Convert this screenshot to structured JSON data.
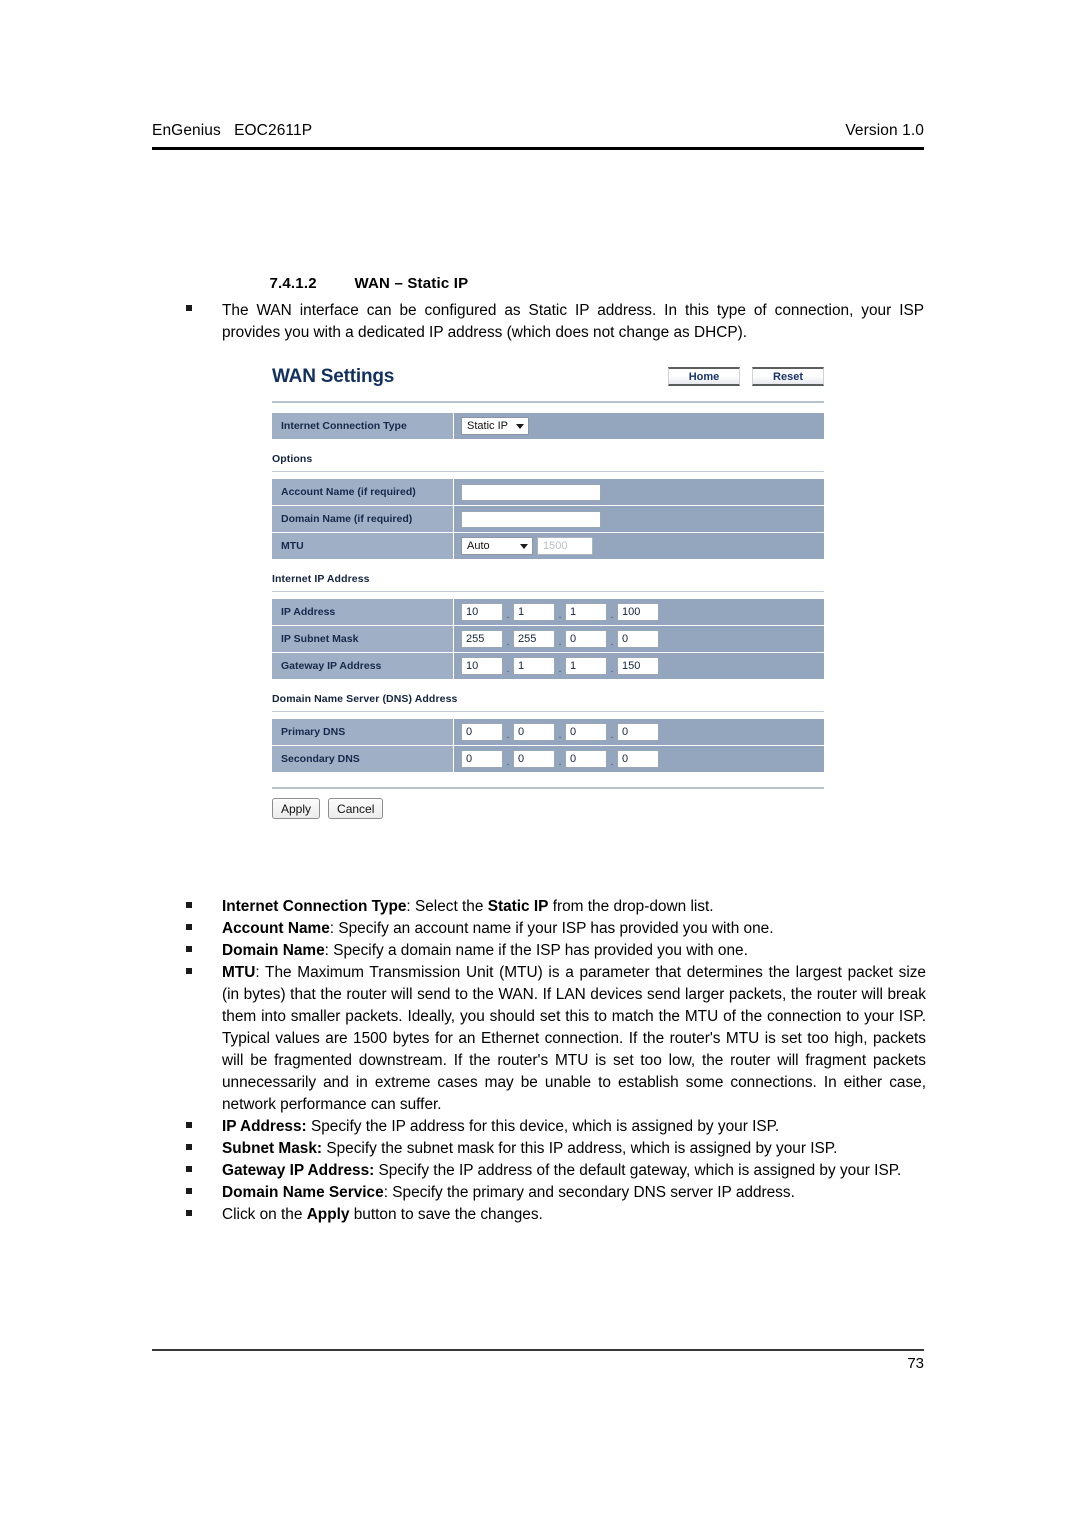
{
  "document": {
    "header_left": "EnGenius   EOC2611P",
    "header_right": "Version 1.0",
    "page_number": "73"
  },
  "section": {
    "number": "7.4.1.2",
    "title": "WAN – Static IP",
    "intro": "The WAN interface can be configured as Static IP address. In this type of connection, your ISP provides you with a dedicated IP address (which does not change as DHCP)."
  },
  "ui": {
    "title": "WAN Settings",
    "buttons": {
      "home": "Home",
      "reset": "Reset"
    },
    "connection_type": {
      "label": "Internet Connection Type",
      "value": "Static IP"
    },
    "options": {
      "heading": "Options",
      "account_name": {
        "label": "Account Name (if required)",
        "value": ""
      },
      "domain_name": {
        "label": "Domain Name (if required)",
        "value": ""
      },
      "mtu": {
        "label": "MTU",
        "mode": "Auto",
        "size": "1500"
      }
    },
    "internet_ip": {
      "heading": "Internet IP Address",
      "ip_address": {
        "label": "IP Address",
        "o1": "10",
        "o2": "1",
        "o3": "1",
        "o4": "100"
      },
      "subnet_mask": {
        "label": "IP Subnet Mask",
        "o1": "255",
        "o2": "255",
        "o3": "0",
        "o4": "0"
      },
      "gateway": {
        "label": "Gateway IP Address",
        "o1": "10",
        "o2": "1",
        "o3": "1",
        "o4": "150"
      }
    },
    "dns": {
      "heading": "Domain Name Server (DNS) Address",
      "primary": {
        "label": "Primary DNS",
        "o1": "0",
        "o2": "0",
        "o3": "0",
        "o4": "0"
      },
      "secondary": {
        "label": "Secondary DNS",
        "o1": "0",
        "o2": "0",
        "o3": "0",
        "o4": "0"
      }
    },
    "form_buttons": {
      "apply": "Apply",
      "cancel": "Cancel"
    },
    "separator": "."
  },
  "descriptions": [
    {
      "term": "Internet Connection Type",
      "rest": ": Select the ",
      "term2": "Static IP",
      "rest2": " from the drop-down list."
    },
    {
      "term": "Account Name",
      "rest": ": Specify an account name if your ISP has provided you with one."
    },
    {
      "term": "Domain Name",
      "rest": ": Specify a domain name if the ISP has provided you with one."
    },
    {
      "term": "MTU",
      "rest": ": The Maximum Transmission Unit (MTU) is a parameter that determines the largest packet size (in bytes) that the router will send to the WAN. If LAN devices send larger packets, the router will break them into smaller packets. Ideally, you should set this to match the MTU of the connection to your ISP. Typical values are 1500 bytes for an Ethernet connection. If the router's MTU is set too high, packets will be fragmented downstream. If the router's MTU is set too low, the router will fragment packets unnecessarily and in extreme cases may be unable to establish some connections. In either case, network performance can suffer."
    },
    {
      "term": "IP Address:",
      "rest": " Specify the IP address for this device, which is assigned by your ISP."
    },
    {
      "term": "Subnet Mask:",
      "rest": " Specify the subnet mask for this IP address, which is assigned by your ISP."
    },
    {
      "term": "Gateway IP Address:",
      "rest": " Specify the IP address of the default gateway, which is assigned by your ISP."
    },
    {
      "term": "Domain Name Service",
      "rest": ": Specify the primary and secondary DNS server IP address."
    },
    {
      "pre": "Click on the ",
      "term": "Apply",
      "rest": " button to save the changes."
    }
  ]
}
